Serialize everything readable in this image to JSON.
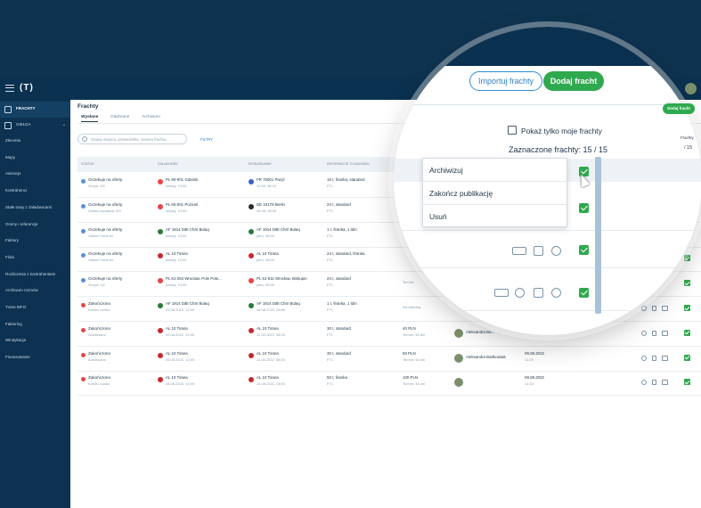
{
  "app": {
    "logo": "(T)"
  },
  "sidebar": {
    "frachty": "FRACHTY",
    "gielda": "GIEŁDA",
    "items": [
      "Zlecenia",
      "Mapy",
      "Awizacje",
      "Kontrahenci",
      "Stałe trasy z załadowcami",
      "Oceny i referencje",
      "Faktury",
      "Flota",
      "Rozliczenia z kontrahentami",
      "Archiwum rozmów",
      "Trans.INFO",
      "Faktoring",
      "Windykacja",
      "Finansowanie"
    ]
  },
  "page": {
    "title": "Frachty",
    "tabs": [
      "Wysłane",
      "Odebrane",
      "Archiwum"
    ],
    "search_placeholder": "Szukaj miejsca, przewoźnika, numeru frachtu...",
    "filter": "FILTRY",
    "add_button_small": "Dodaj fracht"
  },
  "table": {
    "headers": [
      "Status",
      "Załadunek",
      "Rozładunek",
      "Informacje o ładunku"
    ],
    "rows": [
      {
        "status": "Oczekuje na oferty",
        "sub": "Grupa: 5/2",
        "load1": "PL 80-001 Gdańsk",
        "load2": "dzisiaj, 13:00",
        "unload1": "FR 75001 Paryż",
        "unload2": "11.08, 08:00",
        "info1": "15 t, firanka, standard",
        "info2": "FTL",
        "dot": "#5a8fd6",
        "f1": "#e84545",
        "f2": "#3a5fcd"
      },
      {
        "status": "Oczekuje na oferty",
        "sub": "Giełda prywatna: 0/4",
        "load1": "PL 60-001 Poznań",
        "load2": "dzisiaj, 13:00",
        "unload1": "DE 10178 Berlin",
        "unload2": "06.08, 08:00",
        "info1": "24 t, standard",
        "info2": "FTL",
        "dot": "#5a8fd6",
        "f1": "#e84545",
        "f2": "#2a2a2a"
      },
      {
        "status": "Oczekuje na oferty",
        "sub": "Giełda Trans.eu",
        "load1": "AF 1914 Dālī Chōr Bulaq",
        "load2": "dzisiaj, 13:00",
        "unload1": "AF 1914 Dālī Chōr Bulaq",
        "unload2": "jutro, 08:00",
        "info1": "1 t, firanka, 1 ldm",
        "info2": "FTL",
        "dot": "#5a8fd6",
        "f1": "#2a7a3a",
        "f2": "#2a7a3a"
      },
      {
        "status": "Oczekuje na oferty",
        "sub": "Giełda Trans.eu",
        "load1": "AL 10 Tirana",
        "load2": "dzisiaj, 13:00",
        "unload1": "AL 10 Tirana",
        "unload2": "jutro, 08:00",
        "info1": "24 t, standard, firanka",
        "info2": "FTL",
        "dot": "#5a8fd6",
        "f1": "#c7282e",
        "f2": "#c7282e"
      },
      {
        "status": "Oczekuje na oferty",
        "sub": "Grupa: 0/2",
        "load1": "PL 51-254 Wrocław, Pole Pole...",
        "load2": "dzisiaj, 13:00",
        "unload1": "PL 51-611 Wrocław, Biskupin",
        "unload2": "jutro, 08:00",
        "info1": "24 t, standard",
        "info2": "FTL",
        "extra": "Termin:",
        "dot": "#5a8fd6",
        "f1": "#e84545",
        "f2": "#e84545"
      },
      {
        "status": "Zakończono",
        "sub": "Koniec czasu",
        "load1": "AF 1914 Dālī Chōr Bulaq",
        "load2": "25.08.2022, 12:00",
        "unload1": "AF 1914 Dālī Chōr Bulaq",
        "unload2": "26.08.2022, 08:00",
        "info1": "1 t, firanka, 1 ldm",
        "info2": "FTL",
        "extra": "Na zaliczkę",
        "dot": "#e84545",
        "f1": "#2a7a3a",
        "f2": "#2a7a3a"
      },
      {
        "status": "Zakończono",
        "sub": "Anulowano",
        "load1": "AL 10 Tirana",
        "load2": "09.08.2022, 12:00",
        "unload1": "AL 10 Tirana",
        "unload2": "11.08.2022, 08:00",
        "info1": "30 t, standard",
        "info2": "FTL",
        "price": "40 PLN",
        "term": "Termin: 45 dni",
        "person": "Aleksandra Ba...",
        "date1": "09.08.2022",
        "date2": "",
        "dot": "#e84545",
        "f1": "#c7282e",
        "f2": "#c7282e"
      },
      {
        "status": "Zakończono",
        "sub": "Anulowano",
        "load1": "AL 10 Tirana",
        "load2": "09.08.2022, 12:00",
        "unload1": "AL 10 Tirana",
        "unload2": "11.08.2022, 08:00",
        "info1": "30 t, standard",
        "info2": "FTL",
        "price": "50 PLN",
        "term": "Termin: 45 dni",
        "person": "Aleksandra Bartkowiak",
        "date1": "09.08.2022",
        "date2": "12:29",
        "dot": "#e84545",
        "f1": "#c7282e",
        "f2": "#c7282e"
      },
      {
        "status": "Zakończono",
        "sub": "Koniec czasu",
        "load1": "AL 10 Tirana",
        "load2": "08.08.2022, 15:00",
        "unload1": "AL 10 Tirana",
        "unload2": "10.08.2022, 08:00",
        "info1": "50 t, firanka",
        "info2": "FTL",
        "price": "100 PLN",
        "term": "Termin: 45 dni",
        "person": "",
        "date1": "08.08.2022",
        "date2": "14:24",
        "dot": "#e84545",
        "f1": "#c7282e",
        "f2": "#c7282e"
      }
    ]
  },
  "lens": {
    "import_button": "Importuj frachty",
    "add_button": "Dodaj fracht",
    "show_mine": "Pokaż tylko moje frachty",
    "selected": "Zaznaczone frachty: 15 / 15",
    "menu": [
      "Archiwizuj",
      "Zakończ publikację",
      "Usuń"
    ]
  },
  "right_edge": {
    "label": "Frachty",
    "count": "/ 15"
  }
}
